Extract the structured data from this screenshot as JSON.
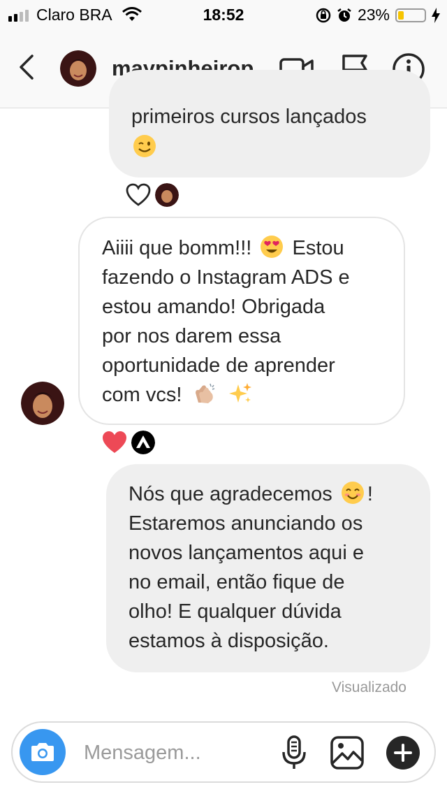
{
  "status_bar": {
    "carrier": "Claro BRA",
    "time": "18:52",
    "battery": "23%",
    "battery_level": 0.23,
    "icons": [
      "signal-icon",
      "wifi-icon",
      "orientation-lock-icon",
      "alarm-icon",
      "battery-icon",
      "charging-bolt-icon"
    ]
  },
  "header": {
    "username": "maypinheirop",
    "icons": [
      "back-chevron-icon",
      "video-call-icon",
      "flag-icon",
      "info-icon"
    ]
  },
  "messages": [
    {
      "direction": "outgoing",
      "lines": [
        "primeiros cursos lançados"
      ],
      "emoji": "winking-face-emoji",
      "reactions": [
        "heart-outline-icon",
        "user-avatar"
      ]
    },
    {
      "direction": "incoming",
      "lines": [
        "Aiiii que bomm!!!",
        "Estou",
        "fazendo o Instagram ADS e",
        "estou amando! Obrigada",
        "por nos darem essa",
        "oportunidade de aprender",
        "com vcs!"
      ],
      "emojis": [
        "heart-eyes-emoji",
        "clapping-hands-emoji",
        "sparkles-emoji"
      ],
      "reactions": [
        "heart-filled-icon",
        "brand-logo-avatar"
      ]
    },
    {
      "direction": "outgoing",
      "lines": [
        "Nós que agradecemos",
        "!",
        "Estaremos anunciando os",
        "novos lançamentos aqui e",
        "no email, então fique de",
        "olho! E qualquer dúvida",
        "estamos à disposição."
      ],
      "emoji": "smiling-face-emoji"
    }
  ],
  "seen_label": "Visualizado",
  "composer": {
    "placeholder": "Mensagem...",
    "icons": [
      "camera-icon",
      "microphone-icon",
      "gallery-icon",
      "plus-icon"
    ]
  },
  "colors": {
    "accent_blue": "#3897f0",
    "heart_red": "#ed4956",
    "bubble_grey": "#efefef",
    "text": "#262626"
  }
}
